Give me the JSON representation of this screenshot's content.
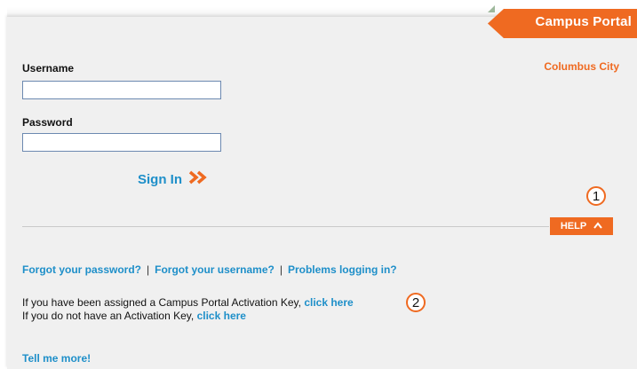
{
  "brand": {
    "title": "Campus Portal"
  },
  "district": "Columbus City",
  "form": {
    "username_label": "Username",
    "username_value": "",
    "password_label": "Password",
    "password_value": "",
    "signin_label": "Sign In",
    "signin_icon": "double-chevron-right-icon"
  },
  "help": {
    "label": "HELP",
    "icon": "chevron-up-icon",
    "marker": "1"
  },
  "links": {
    "forgot_password": "Forgot your password?",
    "forgot_username": "Forgot your username?",
    "problems": "Problems logging in?",
    "separator": "|"
  },
  "activation": {
    "assigned_text": "If you have been assigned a Campus Portal Activation Key,",
    "assigned_link": "click here",
    "assigned_marker": "2",
    "none_text": "If you do not have an Activation Key,",
    "none_link": "click here"
  },
  "tell_more": "Tell me more!",
  "colors": {
    "accent": "#ef6a21",
    "link": "#1e8fc9",
    "background": "#f0f0f0"
  }
}
